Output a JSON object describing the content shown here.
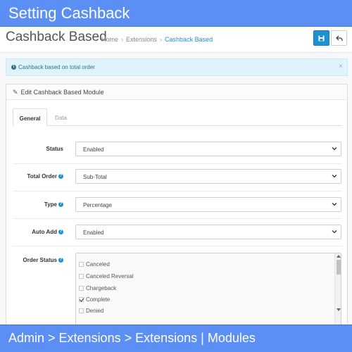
{
  "banner_top": {
    "text": "Setting Cashback"
  },
  "banner_bottom": {
    "text": "Admin > Extensions > Extensions | Modules"
  },
  "header": {
    "title": "Cashback Based",
    "breadcrumb": [
      "Home",
      "Extensions",
      "Cashback Based"
    ],
    "separator": "›",
    "save_icon": "floppy-disk-icon",
    "back_icon": "reply-arrow-icon"
  },
  "alert": {
    "text": "Cashback based on total order",
    "close": "×",
    "icon": "info-circle-icon"
  },
  "panel": {
    "heading": "Edit Cashback Based Module",
    "heading_icon": "pencil-icon",
    "tabs": [
      "General",
      "Data"
    ],
    "active_tab": "General"
  },
  "form": {
    "status": {
      "label": "Status",
      "value": "Enabled"
    },
    "total_order": {
      "label": "Total Order",
      "value": "Sub-Total",
      "help": "?"
    },
    "type": {
      "label": "Type",
      "value": "Percentage",
      "help": "?"
    },
    "auto_add": {
      "label": "Auto Add",
      "value": "Enabled",
      "help": "?"
    },
    "order_status": {
      "label": "Order Status",
      "help": "?",
      "options": [
        {
          "label": "Canceled",
          "checked": false
        },
        {
          "label": "Canceled Reversal",
          "checked": false
        },
        {
          "label": "Chargeback",
          "checked": false
        },
        {
          "label": "Complete",
          "checked": true
        },
        {
          "label": "Denied",
          "checked": false
        }
      ]
    }
  },
  "colors": {
    "banner": "#5b8ff3",
    "primary": "#1e91cf",
    "alert_bg": "#dff3fa",
    "alert_text": "#31708f"
  }
}
